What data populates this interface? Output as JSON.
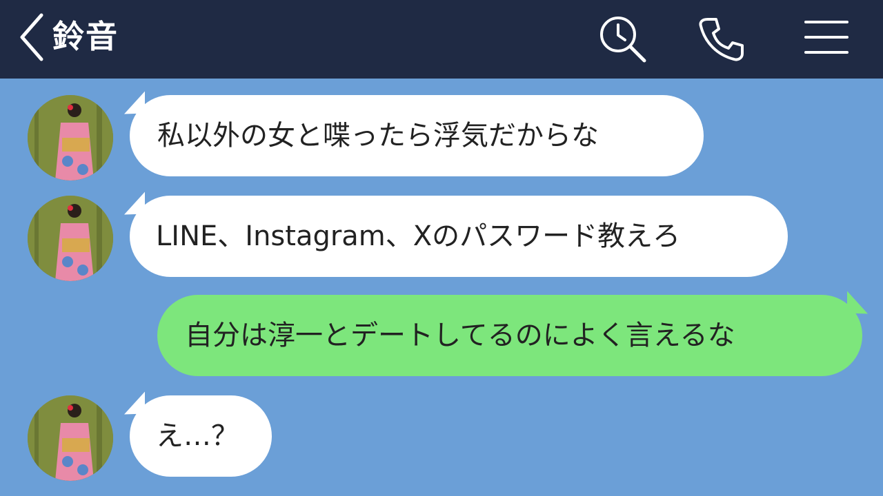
{
  "header": {
    "title": "鈴音",
    "icons": [
      "chevron-left-icon",
      "search-clock-icon",
      "phone-icon",
      "hamburger-menu-icon"
    ]
  },
  "colors": {
    "header_bg": "#1f2a44",
    "chat_bg": "#6b9fd7",
    "incoming_bubble": "#ffffff",
    "outgoing_bubble": "#7de67c"
  },
  "messages": [
    {
      "side": "incoming",
      "text": "私以外の女と喋ったら浮気だからな"
    },
    {
      "side": "incoming",
      "text": "LINE、Instagram、Xのパスワード教えろ"
    },
    {
      "side": "outgoing",
      "text": "自分は淳一とデートしてるのによく言えるな"
    },
    {
      "side": "incoming",
      "text": "え…？"
    }
  ]
}
